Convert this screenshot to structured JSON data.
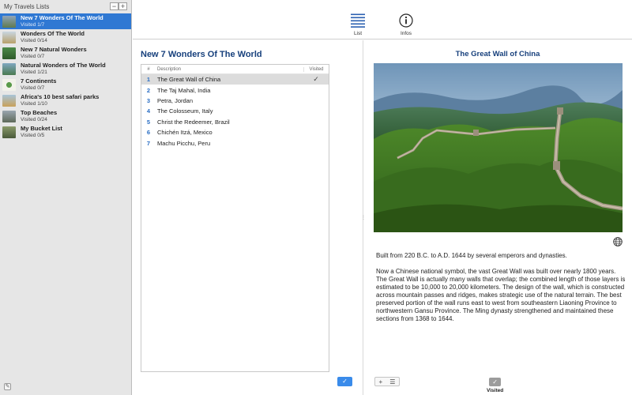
{
  "sidebar": {
    "header": "My Travels Lists",
    "items": [
      {
        "name": "New 7 Wonders Of The World",
        "count": "Visited 1/7",
        "thumb": "#7a8a6a"
      },
      {
        "name": "Wonders Of The World",
        "count": "Visited 0/14",
        "thumb": "#b8a06a"
      },
      {
        "name": "New 7 Natural Wonders",
        "count": "Visited 0/7",
        "thumb": "#3f7a3a"
      },
      {
        "name": "Natural Wonders of The World",
        "count": "Visited 1/21",
        "thumb": "#5a8a6a"
      },
      {
        "name": "7 Continents",
        "count": "Visited 0/7",
        "thumb": "#e8e8e0"
      },
      {
        "name": "Africa's 10 best safari parks",
        "count": "Visited 1/10",
        "thumb": "#c9a15a"
      },
      {
        "name": "Top Beaches",
        "count": "Visited 0/24",
        "thumb": "#6a8aa0"
      },
      {
        "name": "My Bucket List",
        "count": "Visited 0/5",
        "thumb": "#6a7a5a"
      }
    ]
  },
  "toolbar": {
    "list_label": "List",
    "infos_label": "Infos"
  },
  "list": {
    "title": "New 7 Wonders Of The World",
    "columns": {
      "num": "#",
      "desc": "Description",
      "visited": "Visited"
    },
    "rows": [
      {
        "num": "1",
        "desc": "The Great Wall of China",
        "visited": "✓"
      },
      {
        "num": "2",
        "desc": "The Taj Mahal, India",
        "visited": ""
      },
      {
        "num": "3",
        "desc": "Petra, Jordan",
        "visited": ""
      },
      {
        "num": "4",
        "desc": "The Colosseum, Italy",
        "visited": ""
      },
      {
        "num": "5",
        "desc": "Christ the Redeemer, Brazil",
        "visited": ""
      },
      {
        "num": "6",
        "desc": "Chichén Itzá, Mexico",
        "visited": ""
      },
      {
        "num": "7",
        "desc": "Machu Picchu, Peru",
        "visited": ""
      }
    ],
    "done_glyph": "✓"
  },
  "detail": {
    "title": "The Great Wall of China",
    "para1": "Built from 220 B.C. to A.D. 1644 by several emperors and dynasties.",
    "para2": "Now a Chinese national symbol, the vast Great Wall was built over nearly 1800 years. The Great Wall is actually many walls that overlap; the combined length of those layers is estimated to be 10,000 to 20,000 kilometers. The design of the wall, which is constructed across mountain passes and ridges, makes strategic use of the natural terrain. The best preserved portion of the wall runs east to west from southeastern Liaoning Province to northwestern Gansu Province. The Ming dynasty strengthened and maintained these sections from 1368 to 1644.",
    "add_glyph": "+",
    "menu_glyph": "☰",
    "visited_glyph": "✓",
    "visited_label": "Visited"
  },
  "colors": {
    "selection": "#2f78d3",
    "title": "#17407c",
    "accent": "#3a8bea"
  }
}
